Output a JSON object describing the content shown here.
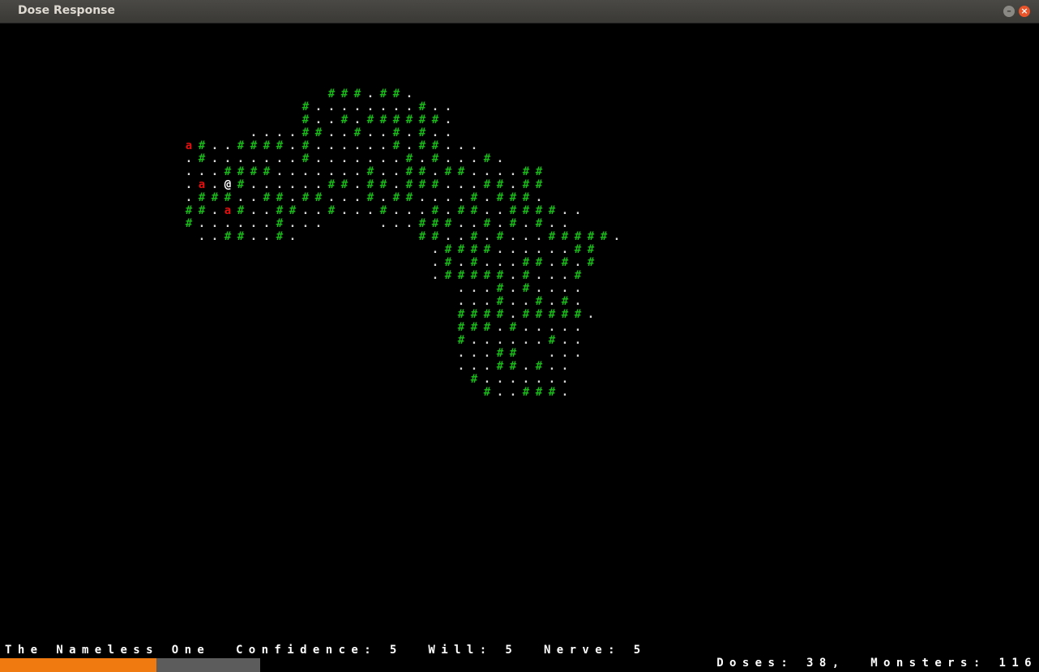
{
  "window": {
    "title": "Dose Response",
    "minimize_label": "–",
    "close_label": "×"
  },
  "map": {
    "rows": [
      {
        "row": 0,
        "col": 25,
        "text": "###.##."
      },
      {
        "row": 1,
        "col": 23,
        "text": "#........#.."
      },
      {
        "row": 2,
        "col": 23,
        "text": "#..#.######."
      },
      {
        "row": 3,
        "col": 19,
        "text": "....##..#..#.#.."
      },
      {
        "row": 4,
        "col": 14,
        "text": "a#..####.#......#.##..."
      },
      {
        "row": 5,
        "col": 14,
        "text": ".#.......#.......#.#...#."
      },
      {
        "row": 6,
        "col": 14,
        "text": "...####.......#..##.##....##"
      },
      {
        "row": 7,
        "col": 14,
        "text": ".a.@#......##.##.###...##.##"
      },
      {
        "row": 8,
        "col": 14,
        "text": ".###..##.##...#.##....#.###."
      },
      {
        "row": 9,
        "col": 14,
        "text": "##.a#..##..#...#...#.##..####.."
      },
      {
        "row": 10,
        "col": 14,
        "text": "#......#...    ...###..#.#.#.."
      },
      {
        "row": 11,
        "col": 15,
        "text": "..##..#.         ##..#.#...#####."
      },
      {
        "row": 12,
        "col": 33,
        "text": ".####......##"
      },
      {
        "row": 13,
        "col": 33,
        "text": ".#.#...##.#.#"
      },
      {
        "row": 14,
        "col": 33,
        "text": ".#####.#...#"
      },
      {
        "row": 15,
        "col": 35,
        "text": "...#.#...."
      },
      {
        "row": 16,
        "col": 35,
        "text": "...#..#.#."
      },
      {
        "row": 17,
        "col": 35,
        "text": "####.#####."
      },
      {
        "row": 18,
        "col": 35,
        "text": "###.#....."
      },
      {
        "row": 19,
        "col": 35,
        "text": "#......#.."
      },
      {
        "row": 20,
        "col": 35,
        "text": "...##  ..."
      },
      {
        "row": 21,
        "col": 35,
        "text": "...##.#.."
      },
      {
        "row": 22,
        "col": 36,
        "text": "#......."
      },
      {
        "row": 23,
        "col": 37,
        "text": "#..###."
      }
    ]
  },
  "status": {
    "player_name": "The Nameless One",
    "confidence_label": "Confidence:",
    "confidence": "5",
    "will_label": "Will:",
    "will": "5",
    "nerve_label": "Nerve:",
    "nerve": "5",
    "doses_label": "Doses:",
    "doses": "38",
    "monsters_label": "Monsters:",
    "monsters": "116",
    "progress_fraction": 0.6
  }
}
